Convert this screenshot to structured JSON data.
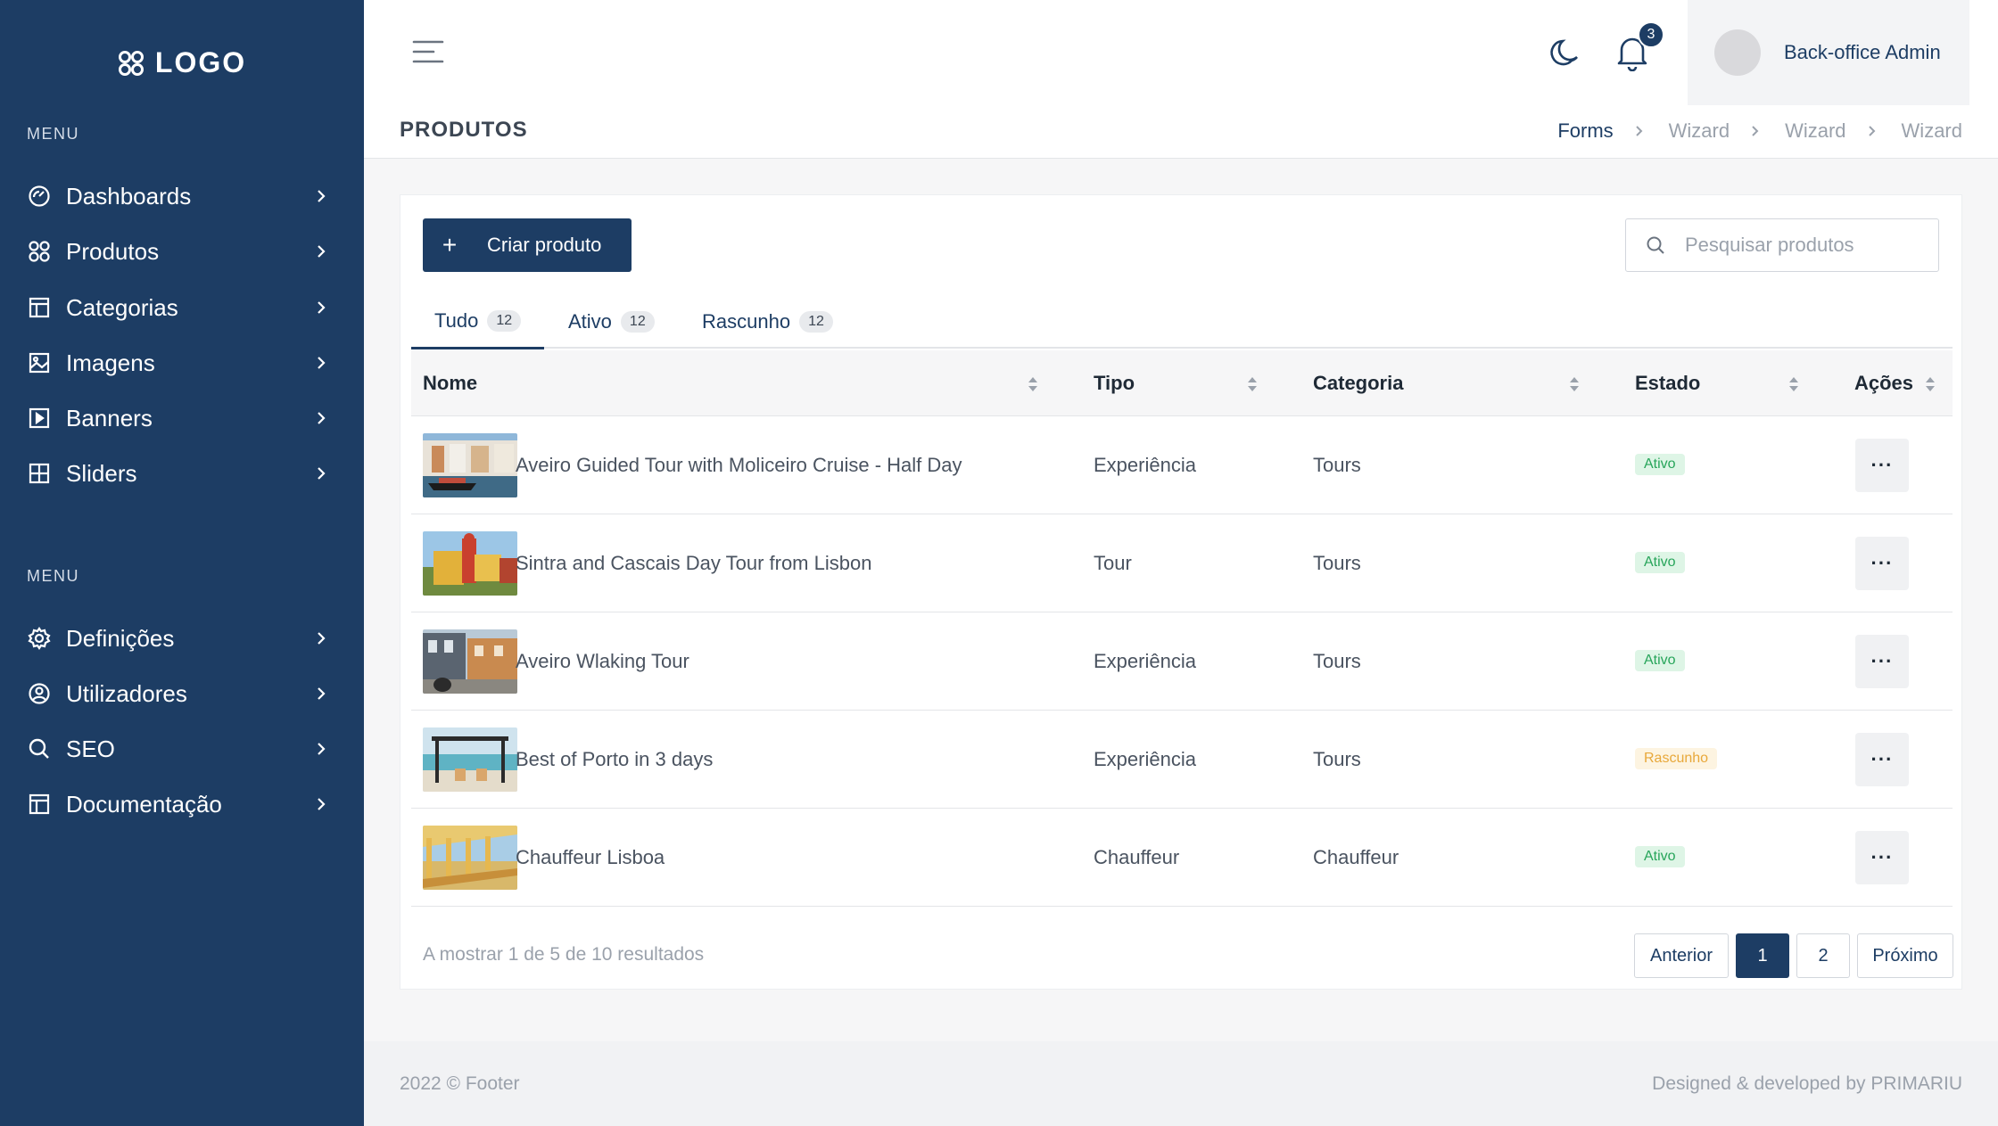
{
  "sidebar": {
    "logo_text": "LOGO",
    "menu1_title": "MENU",
    "menu1": [
      {
        "label": "Dashboards",
        "icon": "dashboard-icon"
      },
      {
        "label": "Produtos",
        "icon": "grid-icon"
      },
      {
        "label": "Categorias",
        "icon": "layout-icon"
      },
      {
        "label": "Imagens",
        "icon": "image-icon"
      },
      {
        "label": "Banners",
        "icon": "play-square-icon"
      },
      {
        "label": "Sliders",
        "icon": "table-icon"
      }
    ],
    "menu2_title": "MENU",
    "menu2": [
      {
        "label": "Definições",
        "icon": "gear-icon"
      },
      {
        "label": "Utilizadores",
        "icon": "user-circle-icon"
      },
      {
        "label": "SEO",
        "icon": "search-icon"
      },
      {
        "label": "Documentação",
        "icon": "layout-icon"
      }
    ]
  },
  "header": {
    "notification_count": "3",
    "user_name": "Back-office Admin"
  },
  "page": {
    "title": "PRODUTOS",
    "breadcrumb": [
      "Forms",
      "Wizard",
      "Wizard",
      "Wizard"
    ]
  },
  "toolbar": {
    "create_label": "Criar produto",
    "search_placeholder": "Pesquisar produtos"
  },
  "tabs": [
    {
      "label": "Tudo",
      "count": "12"
    },
    {
      "label": "Ativo",
      "count": "12"
    },
    {
      "label": "Rascunho",
      "count": "12"
    }
  ],
  "table": {
    "columns": [
      "Nome",
      "Tipo",
      "Categoria",
      "Estado",
      "Ações"
    ],
    "rows": [
      {
        "name": "Aveiro Guided Tour with Moliceiro Cruise - Half Day",
        "type": "Experiência",
        "category": "Tours",
        "status": "Ativo",
        "status_kind": "ativo"
      },
      {
        "name": "Sintra and Cascais Day Tour from Lisbon",
        "type": "Tour",
        "category": "Tours",
        "status": "Ativo",
        "status_kind": "ativo"
      },
      {
        "name": "Aveiro Wlaking Tour",
        "type": "Experiência",
        "category": "Tours",
        "status": "Ativo",
        "status_kind": "ativo"
      },
      {
        "name": "Best of Porto in 3 days",
        "type": "Experiência",
        "category": "Tours",
        "status": "Rascunho",
        "status_kind": "rascunho"
      },
      {
        "name": "Chauffeur Lisboa",
        "type": "Chauffeur",
        "category": "Chauffeur",
        "status": "Ativo",
        "status_kind": "ativo"
      }
    ],
    "actions_label": "···"
  },
  "pagination": {
    "summary": "A mostrar 1 de 5 de 10 resultados",
    "prev": "Anterior",
    "pages": [
      "1",
      "2"
    ],
    "next": "Próximo"
  },
  "footer": {
    "left": "2022 © Footer",
    "right": "Designed & developed by PRIMARIU"
  },
  "colors": {
    "sidebar_bg": "#1d3d64",
    "accent": "#1d3d64",
    "ativo": "#27a55a",
    "rascunho": "#e8a83a"
  }
}
